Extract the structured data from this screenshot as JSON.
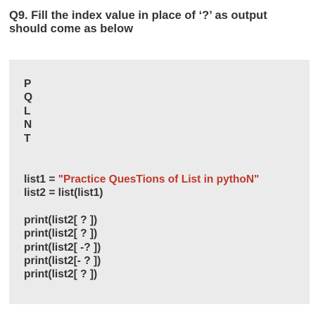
{
  "question": {
    "line1": "Q9. Fill the index value in place of ‘?’ as output",
    "line2": "should come as below"
  },
  "output_lines": [
    "P",
    "Q",
    "L",
    "N",
    "T"
  ],
  "code": {
    "line1_prefix": "list1 = ",
    "line1_string": "\"Practice QuesTions of List in pythoN\"",
    "line2": "list2 = list(list1)",
    "prints": [
      "print(list2[ ? ])",
      "print(list2[ ? ])",
      "print(list2[ -? ])",
      "print(list2[- ? ])",
      "print(list2[ ? ])"
    ]
  },
  "colors": {
    "text": "#333333",
    "string": "#c0392b",
    "box_background": "#ebebeb"
  }
}
